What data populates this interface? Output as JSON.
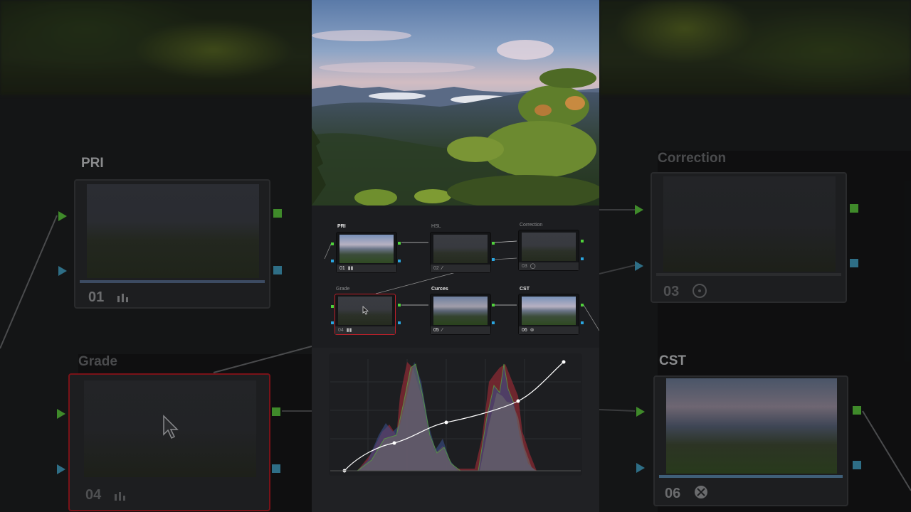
{
  "left_panel": {
    "node_top": {
      "title": "PRI",
      "number": "01"
    },
    "node_bottom": {
      "title": "Grade",
      "number": "04"
    }
  },
  "right_panel": {
    "node_top": {
      "title": "Correction",
      "number": "03"
    },
    "node_bottom": {
      "title": "CST",
      "number": "06"
    }
  },
  "node_graph": {
    "nodes": [
      {
        "title": "PRI",
        "number": "01",
        "tool_icon": "bars-icon",
        "active": true
      },
      {
        "title": "HSL",
        "number": "02",
        "tool_icon": "curve-pen-icon",
        "active": false
      },
      {
        "title": "Correction",
        "number": "03",
        "tool_icon": "circle-icon",
        "active": false
      },
      {
        "title": "Grade",
        "number": "04",
        "tool_icon": "bars-icon",
        "active": false,
        "selected": true
      },
      {
        "title": "Curces",
        "number": "05",
        "tool_icon": "curve-pen-icon",
        "active": true
      },
      {
        "title": "CST",
        "number": "06",
        "tool_icon": "cst-icon",
        "active": true
      }
    ]
  },
  "colors": {
    "input_green": "#4fd23a",
    "input_blue": "#2aa6e0",
    "selected_border": "#c0202a",
    "histogram_red": "#c0303a",
    "histogram_green": "#5aa040",
    "histogram_blue": "#3a5ab0"
  },
  "icons": [
    "bars-icon",
    "curve-pen-icon",
    "circle-icon",
    "cst-icon",
    "mouse-cursor-icon"
  ]
}
